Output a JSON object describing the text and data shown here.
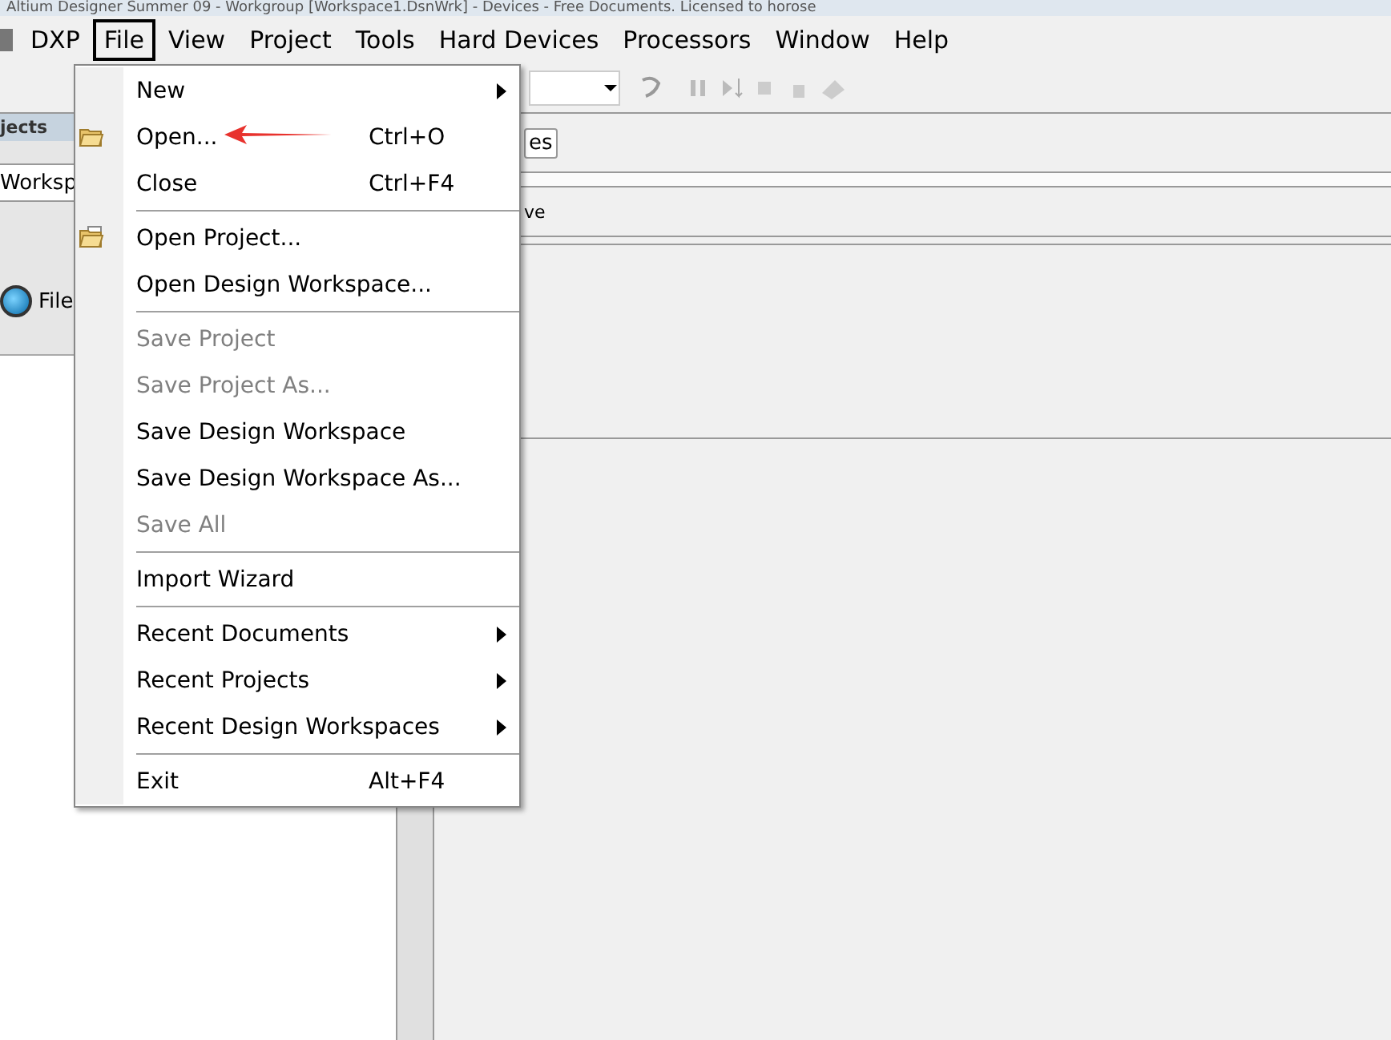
{
  "window": {
    "title": "Altium Designer Summer 09 - Workgroup [Workspace1.DsnWrk] - Devices - Free Documents. Licensed to horose"
  },
  "menu_bar": [
    {
      "label": "DXP",
      "selected": false
    },
    {
      "label": "File",
      "selected": true
    },
    {
      "label": "View",
      "selected": false
    },
    {
      "label": "Project",
      "selected": false
    },
    {
      "label": "Tools",
      "selected": false
    },
    {
      "label": "Hard Devices",
      "selected": false
    },
    {
      "label": "Processors",
      "selected": false
    },
    {
      "label": "Window",
      "selected": false
    },
    {
      "label": "Help",
      "selected": false
    }
  ],
  "left_panel": {
    "header": "jects",
    "workspace_button": "Worksp",
    "radio_label": "File",
    "radio_checked": true
  },
  "content": {
    "button_label": "es",
    "text": "ve"
  },
  "file_menu": [
    {
      "kind": "item",
      "label": "New",
      "submenu": true,
      "disabled": false
    },
    {
      "kind": "folder-item",
      "label": "Open...",
      "shortcut": "Ctrl+O",
      "disabled": false
    },
    {
      "kind": "item",
      "label": "Close",
      "shortcut": "Ctrl+F4",
      "disabled": false
    },
    {
      "kind": "separator"
    },
    {
      "kind": "project-item",
      "label": "Open Project...",
      "disabled": false
    },
    {
      "kind": "item",
      "label": "Open Design Workspace...",
      "disabled": false
    },
    {
      "kind": "separator"
    },
    {
      "kind": "item",
      "label": "Save Project",
      "disabled": true
    },
    {
      "kind": "item",
      "label": "Save Project As...",
      "disabled": true
    },
    {
      "kind": "item",
      "label": "Save Design Workspace",
      "disabled": false
    },
    {
      "kind": "item",
      "label": "Save Design Workspace As...",
      "disabled": false
    },
    {
      "kind": "item",
      "label": "Save All",
      "disabled": true
    },
    {
      "kind": "separator"
    },
    {
      "kind": "item",
      "label": "Import Wizard",
      "disabled": false
    },
    {
      "kind": "separator"
    },
    {
      "kind": "item",
      "label": "Recent Documents",
      "submenu": true,
      "disabled": false
    },
    {
      "kind": "item",
      "label": "Recent Projects",
      "submenu": true,
      "disabled": false
    },
    {
      "kind": "item",
      "label": "Recent Design Workspaces",
      "submenu": true,
      "disabled": false
    },
    {
      "kind": "separator"
    },
    {
      "kind": "item",
      "label": "Exit",
      "shortcut": "Alt+F4",
      "disabled": false
    }
  ]
}
